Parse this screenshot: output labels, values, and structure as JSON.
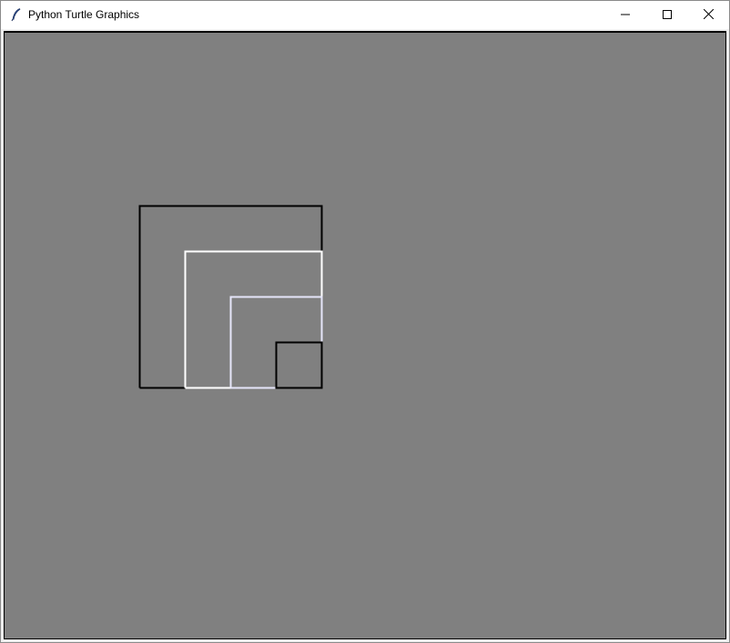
{
  "window": {
    "title": "Python Turtle Graphics",
    "app_icon": "feather-icon",
    "controls": {
      "minimize": "minimize-icon",
      "maximize": "maximize-icon",
      "close": "close-icon"
    }
  },
  "canvas": {
    "background": "#808080",
    "shapes": [
      {
        "name": "square-large-black",
        "color": "#000000"
      },
      {
        "name": "square-medium-white",
        "color": "#ffffff"
      },
      {
        "name": "square-small-lavender",
        "color": "#e6e6fa"
      },
      {
        "name": "square-tiny-black",
        "color": "#000000"
      }
    ]
  }
}
